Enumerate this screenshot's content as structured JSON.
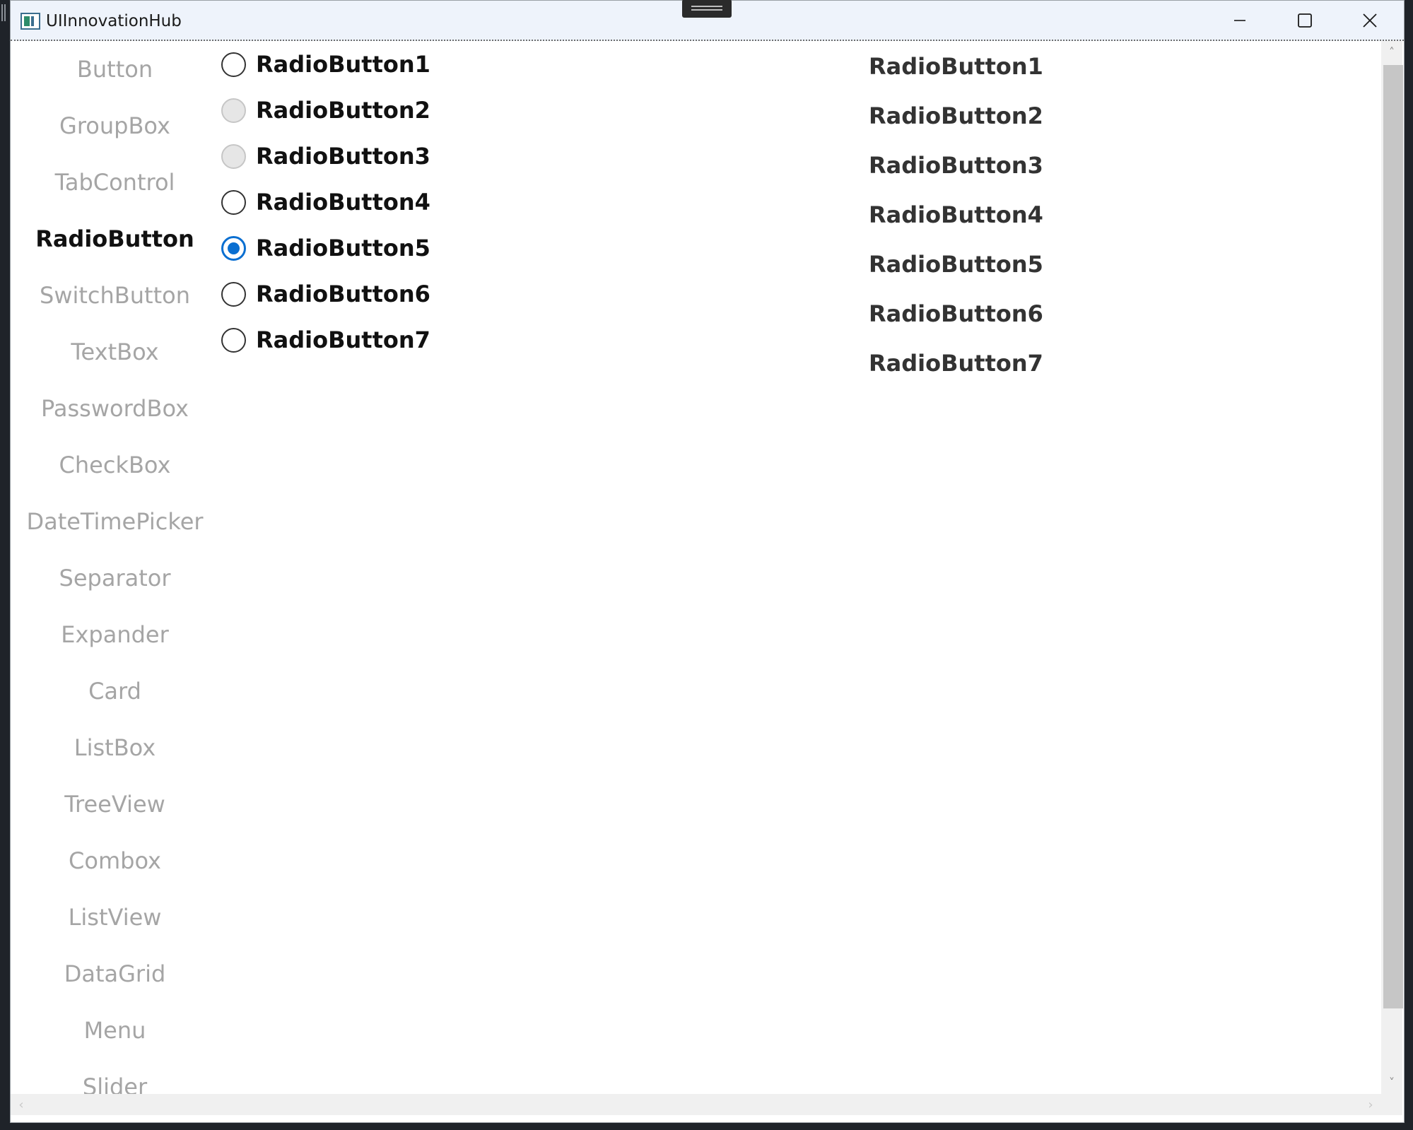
{
  "window": {
    "title": "UIInnovationHub",
    "minimize_label": "Minimize",
    "maximize_label": "Maximize",
    "close_label": "Close"
  },
  "nav": {
    "items": [
      {
        "label": "Button",
        "active": false
      },
      {
        "label": "GroupBox",
        "active": false
      },
      {
        "label": "TabControl",
        "active": false
      },
      {
        "label": "RadioButton",
        "active": true
      },
      {
        "label": "SwitchButton",
        "active": false
      },
      {
        "label": "TextBox",
        "active": false
      },
      {
        "label": "PasswordBox",
        "active": false
      },
      {
        "label": "CheckBox",
        "active": false
      },
      {
        "label": "DateTimePicker",
        "active": false
      },
      {
        "label": "Separator",
        "active": false
      },
      {
        "label": "Expander",
        "active": false
      },
      {
        "label": "Card",
        "active": false
      },
      {
        "label": "ListBox",
        "active": false
      },
      {
        "label": "TreeView",
        "active": false
      },
      {
        "label": "Combox",
        "active": false
      },
      {
        "label": "ListView",
        "active": false
      },
      {
        "label": "DataGrid",
        "active": false
      },
      {
        "label": "Menu",
        "active": false
      },
      {
        "label": "Slider",
        "active": false
      }
    ]
  },
  "radios": [
    {
      "label": "RadioButton1",
      "checked": false,
      "disabled": false
    },
    {
      "label": "RadioButton2",
      "checked": false,
      "disabled": true
    },
    {
      "label": "RadioButton3",
      "checked": false,
      "disabled": true
    },
    {
      "label": "RadioButton4",
      "checked": false,
      "disabled": false
    },
    {
      "label": "RadioButton5",
      "checked": true,
      "disabled": false
    },
    {
      "label": "RadioButton6",
      "checked": false,
      "disabled": false
    },
    {
      "label": "RadioButton7",
      "checked": false,
      "disabled": false
    }
  ],
  "styled_radios": [
    {
      "label": "RadioButton1"
    },
    {
      "label": "RadioButton2"
    },
    {
      "label": "RadioButton3"
    },
    {
      "label": "RadioButton4"
    },
    {
      "label": "RadioButton5"
    },
    {
      "label": "RadioButton6"
    },
    {
      "label": "RadioButton7"
    }
  ],
  "colors": {
    "accent": "#0a6fd1",
    "nav_inactive": "#a5a5a5",
    "titlebar": "#eef3fb"
  },
  "icons": {
    "app": "app-window-icon",
    "minimize": "minimize-icon",
    "maximize": "maximize-icon",
    "close": "close-icon"
  }
}
